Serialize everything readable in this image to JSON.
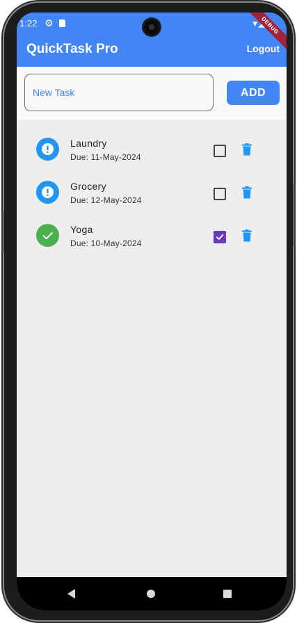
{
  "status_bar": {
    "time": "1:22",
    "settings_icon": "gear-icon",
    "sd_icon": "sd-card-icon",
    "right_icons": "▾◢▮",
    "debug_label": "DEBUG"
  },
  "app_bar": {
    "title": "QuickTask Pro",
    "logout_label": "Logout",
    "color": "#4285f4"
  },
  "new_task": {
    "placeholder": "New Task",
    "value": "",
    "add_label": "ADD"
  },
  "tasks": [
    {
      "title": "Laundry",
      "due": "Due: 11-May-2024",
      "completed": false,
      "status_icon": "exclamation-icon",
      "status_color": "#2196f3"
    },
    {
      "title": "Grocery",
      "due": "Due: 12-May-2024",
      "completed": false,
      "status_icon": "exclamation-icon",
      "status_color": "#2196f3"
    },
    {
      "title": "Yoga",
      "due": "Due: 10-May-2024",
      "completed": true,
      "status_icon": "checkmark-icon",
      "status_color": "#4caf50"
    }
  ],
  "colors": {
    "delete_icon": "#2196f3",
    "checked_box": "#673ab7",
    "background": "#eeeeee"
  },
  "nav_bar": {
    "back_icon": "back-triangle-icon",
    "home_icon": "home-circle-icon",
    "recents_icon": "recents-square-icon"
  }
}
